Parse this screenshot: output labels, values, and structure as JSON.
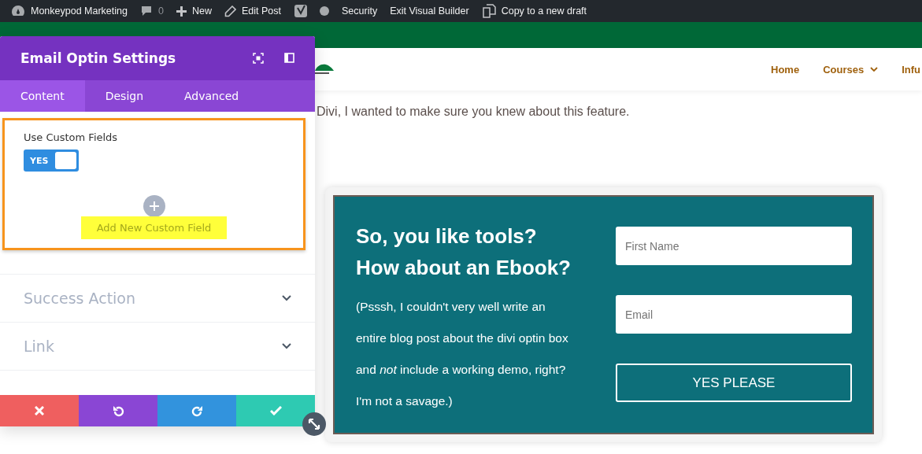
{
  "admin_bar": {
    "items": [
      {
        "kind": "site",
        "label": "Monkeypod Marketing"
      },
      {
        "kind": "comments",
        "label": "0"
      },
      {
        "kind": "new",
        "label": "New"
      },
      {
        "kind": "edit",
        "label": "Edit Post"
      },
      {
        "kind": "seo"
      },
      {
        "kind": "plain",
        "label": "Security"
      },
      {
        "kind": "plain",
        "label": "Exit Visual Builder"
      },
      {
        "kind": "copy",
        "label": "Copy to a new draft"
      }
    ]
  },
  "site_nav": [
    {
      "label": "Home",
      "has_menu": false
    },
    {
      "label": "Courses",
      "has_menu": true
    },
    {
      "label": "Infu",
      "has_menu": false
    }
  ],
  "intro_text": "Divi, I wanted to make sure you knew about this feature.",
  "optin": {
    "heading": "So, you like tools? How about an Ebook?",
    "body": "(Psssh, I couldn't very well write an entire blog post about the divi optin box and *not* include a working demo, right? I'm not a savage.)",
    "fields": [
      {
        "placeholder": "First Name"
      },
      {
        "placeholder": "Email"
      }
    ],
    "button": "YES PLEASE"
  },
  "settings_panel": {
    "title": "Email Optin Settings",
    "tabs": [
      {
        "label": "Content",
        "selected": true
      },
      {
        "label": "Design",
        "selected": false
      },
      {
        "label": "Advanced",
        "selected": false
      }
    ],
    "toggle": {
      "label": "Use Custom Fields",
      "state_text": "YES",
      "on": true
    },
    "add_button": "Add New Custom Field",
    "sections": [
      {
        "label": "Success Action",
        "expanded": false
      },
      {
        "label": "Link",
        "expanded": false
      }
    ],
    "footer_buttons": [
      {
        "kind": "cancel"
      },
      {
        "kind": "undo"
      },
      {
        "kind": "redo"
      },
      {
        "kind": "save"
      }
    ]
  }
}
